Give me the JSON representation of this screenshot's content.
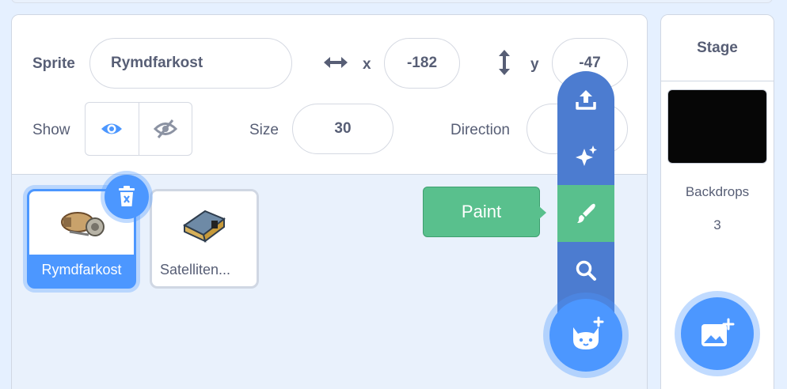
{
  "sprite_info": {
    "sprite_label": "Sprite",
    "sprite_name": "Rymdfarkost",
    "x_label": "x",
    "x_value": "-182",
    "y_label": "y",
    "y_value": "-47",
    "show_label": "Show",
    "size_label": "Size",
    "size_value": "30",
    "direction_label": "Direction",
    "direction_value": ""
  },
  "sprites": [
    {
      "name": "Rymdfarkost",
      "selected": true
    },
    {
      "name": "Satelliten...",
      "selected": false
    }
  ],
  "sprite_menu": {
    "tooltip": "Paint",
    "items": [
      "upload-icon",
      "surprise-icon",
      "paint-icon",
      "search-icon"
    ]
  },
  "stage": {
    "title": "Stage",
    "backdrops_label": "Backdrops",
    "backdrops_count": "3"
  },
  "colors": {
    "accent": "#4c97ff",
    "menu_blue": "#4c7cd0",
    "paint_green": "#59c08d",
    "text": "#575e75"
  }
}
